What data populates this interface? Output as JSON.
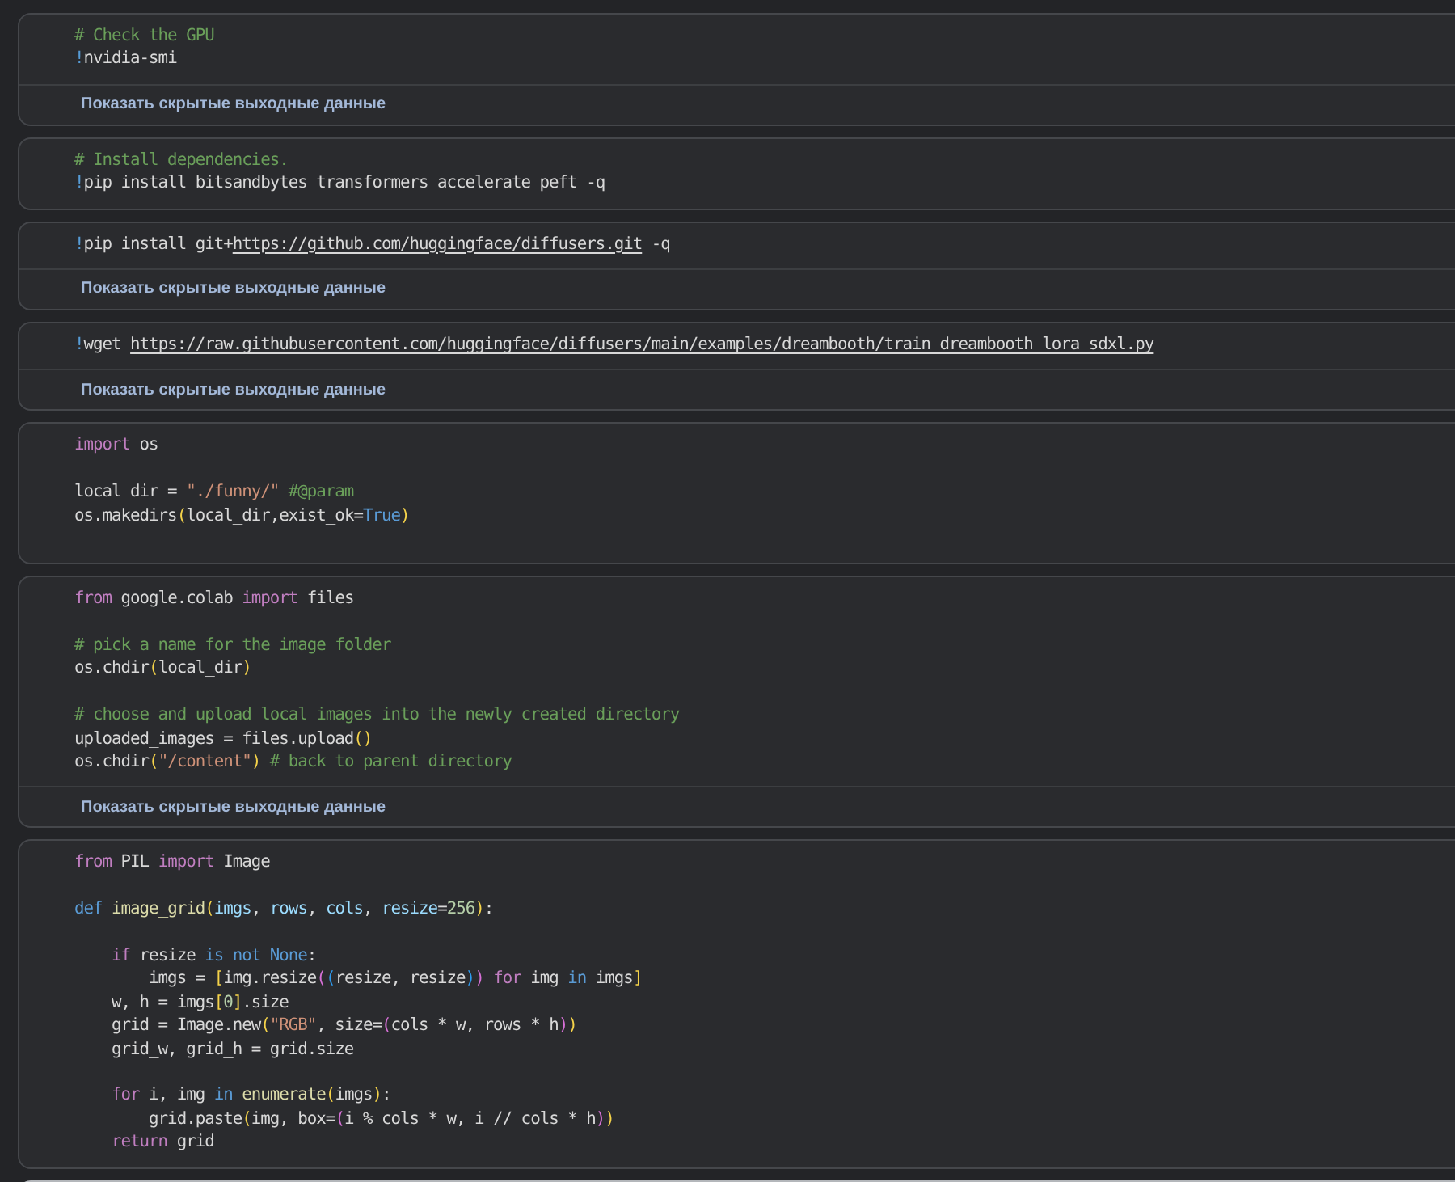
{
  "cells": [
    {
      "selected": false,
      "trailing_blank_line": false,
      "code_blocks": [
        {
          "lines": [
            [
              {
                "text": "# Check the GPU",
                "kind": "comment"
              }
            ],
            [
              {
                "text": "!",
                "kind": "magic"
              },
              {
                "text": "nvidia-smi",
                "kind": "plain"
              }
            ]
          ]
        }
      ],
      "output_toggle": "Показать скрытые выходные данные"
    },
    {
      "selected": false,
      "trailing_blank_line": false,
      "code_blocks": [
        {
          "lines": [
            [
              {
                "text": "# Install dependencies.",
                "kind": "comment"
              }
            ],
            [
              {
                "text": "!",
                "kind": "magic"
              },
              {
                "text": "pip install bitsandbytes transformers accelerate peft -q",
                "kind": "plain"
              }
            ]
          ]
        }
      ]
    },
    {
      "selected": false,
      "trailing_blank_line": false,
      "code_blocks": [
        {
          "lines": [
            [
              {
                "text": "!",
                "kind": "magic"
              },
              {
                "text": "pip install git+",
                "kind": "plain"
              },
              {
                "text": "https://github.com/huggingface/diffusers.git",
                "kind": "link"
              },
              {
                "text": " -q",
                "kind": "plain"
              }
            ]
          ]
        }
      ],
      "output_toggle": "Показать скрытые выходные данные"
    },
    {
      "selected": false,
      "trailing_blank_line": false,
      "code_blocks": [
        {
          "lines": [
            [
              {
                "text": "!",
                "kind": "magic"
              },
              {
                "text": "wget ",
                "kind": "plain"
              },
              {
                "text": "https://raw.githubusercontent.com/huggingface/diffusers/main/examples/dreambooth/train_dreambooth_lora_sdxl.py",
                "kind": "link"
              }
            ]
          ]
        }
      ],
      "output_toggle": "Показать скрытые выходные данные"
    },
    {
      "selected": false,
      "trailing_blank_line": true,
      "code_blocks": [
        {
          "lines": [
            [
              {
                "text": "import",
                "kind": "control"
              },
              {
                "text": " os",
                "kind": "plain"
              }
            ]
          ]
        },
        {
          "lines": [
            [
              {
                "text": "local_dir = ",
                "kind": "plain"
              },
              {
                "text": "\"./funny/\"",
                "kind": "string"
              },
              {
                "text": " #@param",
                "kind": "comment"
              }
            ],
            [
              {
                "text": "os.makedirs",
                "kind": "plain"
              },
              {
                "text": "(",
                "kind": "bracket1"
              },
              {
                "text": "local_dir,exist_ok=",
                "kind": "plain"
              },
              {
                "text": "True",
                "kind": "keyword"
              },
              {
                "text": ")",
                "kind": "bracket1"
              }
            ]
          ]
        }
      ]
    },
    {
      "selected": false,
      "trailing_blank_line": false,
      "code_blocks": [
        {
          "lines": [
            [
              {
                "text": "from",
                "kind": "control"
              },
              {
                "text": " google.colab ",
                "kind": "plain"
              },
              {
                "text": "import",
                "kind": "control"
              },
              {
                "text": " files",
                "kind": "plain"
              }
            ]
          ]
        },
        {
          "lines": [
            [
              {
                "text": "# pick a name for the image folder",
                "kind": "comment"
              }
            ],
            [
              {
                "text": "os.chdir",
                "kind": "plain"
              },
              {
                "text": "(",
                "kind": "bracket1"
              },
              {
                "text": "local_dir",
                "kind": "plain"
              },
              {
                "text": ")",
                "kind": "bracket1"
              }
            ]
          ]
        },
        {
          "lines": [
            [
              {
                "text": "# choose and upload local images into the newly created directory",
                "kind": "comment"
              }
            ],
            [
              {
                "text": "uploaded_images = files.upload",
                "kind": "plain"
              },
              {
                "text": "()",
                "kind": "bracket1"
              }
            ],
            [
              {
                "text": "os.chdir",
                "kind": "plain"
              },
              {
                "text": "(",
                "kind": "bracket1"
              },
              {
                "text": "\"/content\"",
                "kind": "string"
              },
              {
                "text": ")",
                "kind": "bracket1"
              },
              {
                "text": " # back to parent directory",
                "kind": "comment"
              }
            ]
          ]
        }
      ],
      "output_toggle": "Показать скрытые выходные данные"
    },
    {
      "selected": false,
      "trailing_blank_line": false,
      "code_blocks": [
        {
          "lines": [
            [
              {
                "text": "from",
                "kind": "control"
              },
              {
                "text": " PIL ",
                "kind": "plain"
              },
              {
                "text": "import",
                "kind": "control"
              },
              {
                "text": " Image",
                "kind": "plain"
              }
            ]
          ]
        },
        {
          "lines": [
            [
              {
                "text": "def",
                "kind": "keyword"
              },
              {
                "text": " image_grid",
                "kind": "function"
              },
              {
                "text": "(",
                "kind": "bracket1"
              },
              {
                "text": "imgs",
                "kind": "param"
              },
              {
                "text": ", ",
                "kind": "plain"
              },
              {
                "text": "rows",
                "kind": "param"
              },
              {
                "text": ", ",
                "kind": "plain"
              },
              {
                "text": "cols",
                "kind": "param"
              },
              {
                "text": ", ",
                "kind": "plain"
              },
              {
                "text": "resize",
                "kind": "param"
              },
              {
                "text": "=",
                "kind": "plain"
              },
              {
                "text": "256",
                "kind": "number"
              },
              {
                "text": ")",
                "kind": "bracket1"
              },
              {
                "text": ":",
                "kind": "plain"
              }
            ]
          ]
        },
        {
          "lines": [
            [
              {
                "text": "    if",
                "kind": "control"
              },
              {
                "text": " resize ",
                "kind": "plain"
              },
              {
                "text": "is not None",
                "kind": "keyword"
              },
              {
                "text": ":",
                "kind": "plain"
              }
            ],
            [
              {
                "text": "        imgs = ",
                "kind": "plain"
              },
              {
                "text": "[",
                "kind": "bracket1"
              },
              {
                "text": "img.resize",
                "kind": "plain"
              },
              {
                "text": "(",
                "kind": "bracket2"
              },
              {
                "text": "(",
                "kind": "bracket3"
              },
              {
                "text": "resize, resize",
                "kind": "plain"
              },
              {
                "text": ")",
                "kind": "bracket3"
              },
              {
                "text": ")",
                "kind": "bracket2"
              },
              {
                "text": " for",
                "kind": "control"
              },
              {
                "text": " img ",
                "kind": "plain"
              },
              {
                "text": "in",
                "kind": "keyword"
              },
              {
                "text": " imgs",
                "kind": "plain"
              },
              {
                "text": "]",
                "kind": "bracket1"
              }
            ],
            [
              {
                "text": "    w, h = imgs",
                "kind": "plain"
              },
              {
                "text": "[",
                "kind": "bracket1"
              },
              {
                "text": "0",
                "kind": "number"
              },
              {
                "text": "]",
                "kind": "bracket1"
              },
              {
                "text": ".size",
                "kind": "plain"
              }
            ],
            [
              {
                "text": "    grid = Image.new",
                "kind": "plain"
              },
              {
                "text": "(",
                "kind": "bracket1"
              },
              {
                "text": "\"RGB\"",
                "kind": "string"
              },
              {
                "text": ", size=",
                "kind": "plain"
              },
              {
                "text": "(",
                "kind": "bracket2"
              },
              {
                "text": "cols * w, rows * h",
                "kind": "plain"
              },
              {
                "text": ")",
                "kind": "bracket2"
              },
              {
                "text": ")",
                "kind": "bracket1"
              }
            ],
            [
              {
                "text": "    grid_w, grid_h = grid.size",
                "kind": "plain"
              }
            ]
          ]
        },
        {
          "lines": [
            [
              {
                "text": "    for",
                "kind": "control"
              },
              {
                "text": " i, img ",
                "kind": "plain"
              },
              {
                "text": "in",
                "kind": "keyword"
              },
              {
                "text": " enumerate",
                "kind": "function"
              },
              {
                "text": "(",
                "kind": "bracket1"
              },
              {
                "text": "imgs",
                "kind": "plain"
              },
              {
                "text": ")",
                "kind": "bracket1"
              },
              {
                "text": ":",
                "kind": "plain"
              }
            ],
            [
              {
                "text": "        grid.paste",
                "kind": "plain"
              },
              {
                "text": "(",
                "kind": "bracket1"
              },
              {
                "text": "img, box=",
                "kind": "plain"
              },
              {
                "text": "(",
                "kind": "bracket2"
              },
              {
                "text": "i % cols * w, i // cols * h",
                "kind": "plain"
              },
              {
                "text": ")",
                "kind": "bracket2"
              },
              {
                "text": ")",
                "kind": "bracket1"
              }
            ],
            [
              {
                "text": "    return",
                "kind": "control"
              },
              {
                "text": " grid",
                "kind": "plain"
              }
            ]
          ]
        }
      ]
    },
    {
      "selected": true
    }
  ]
}
